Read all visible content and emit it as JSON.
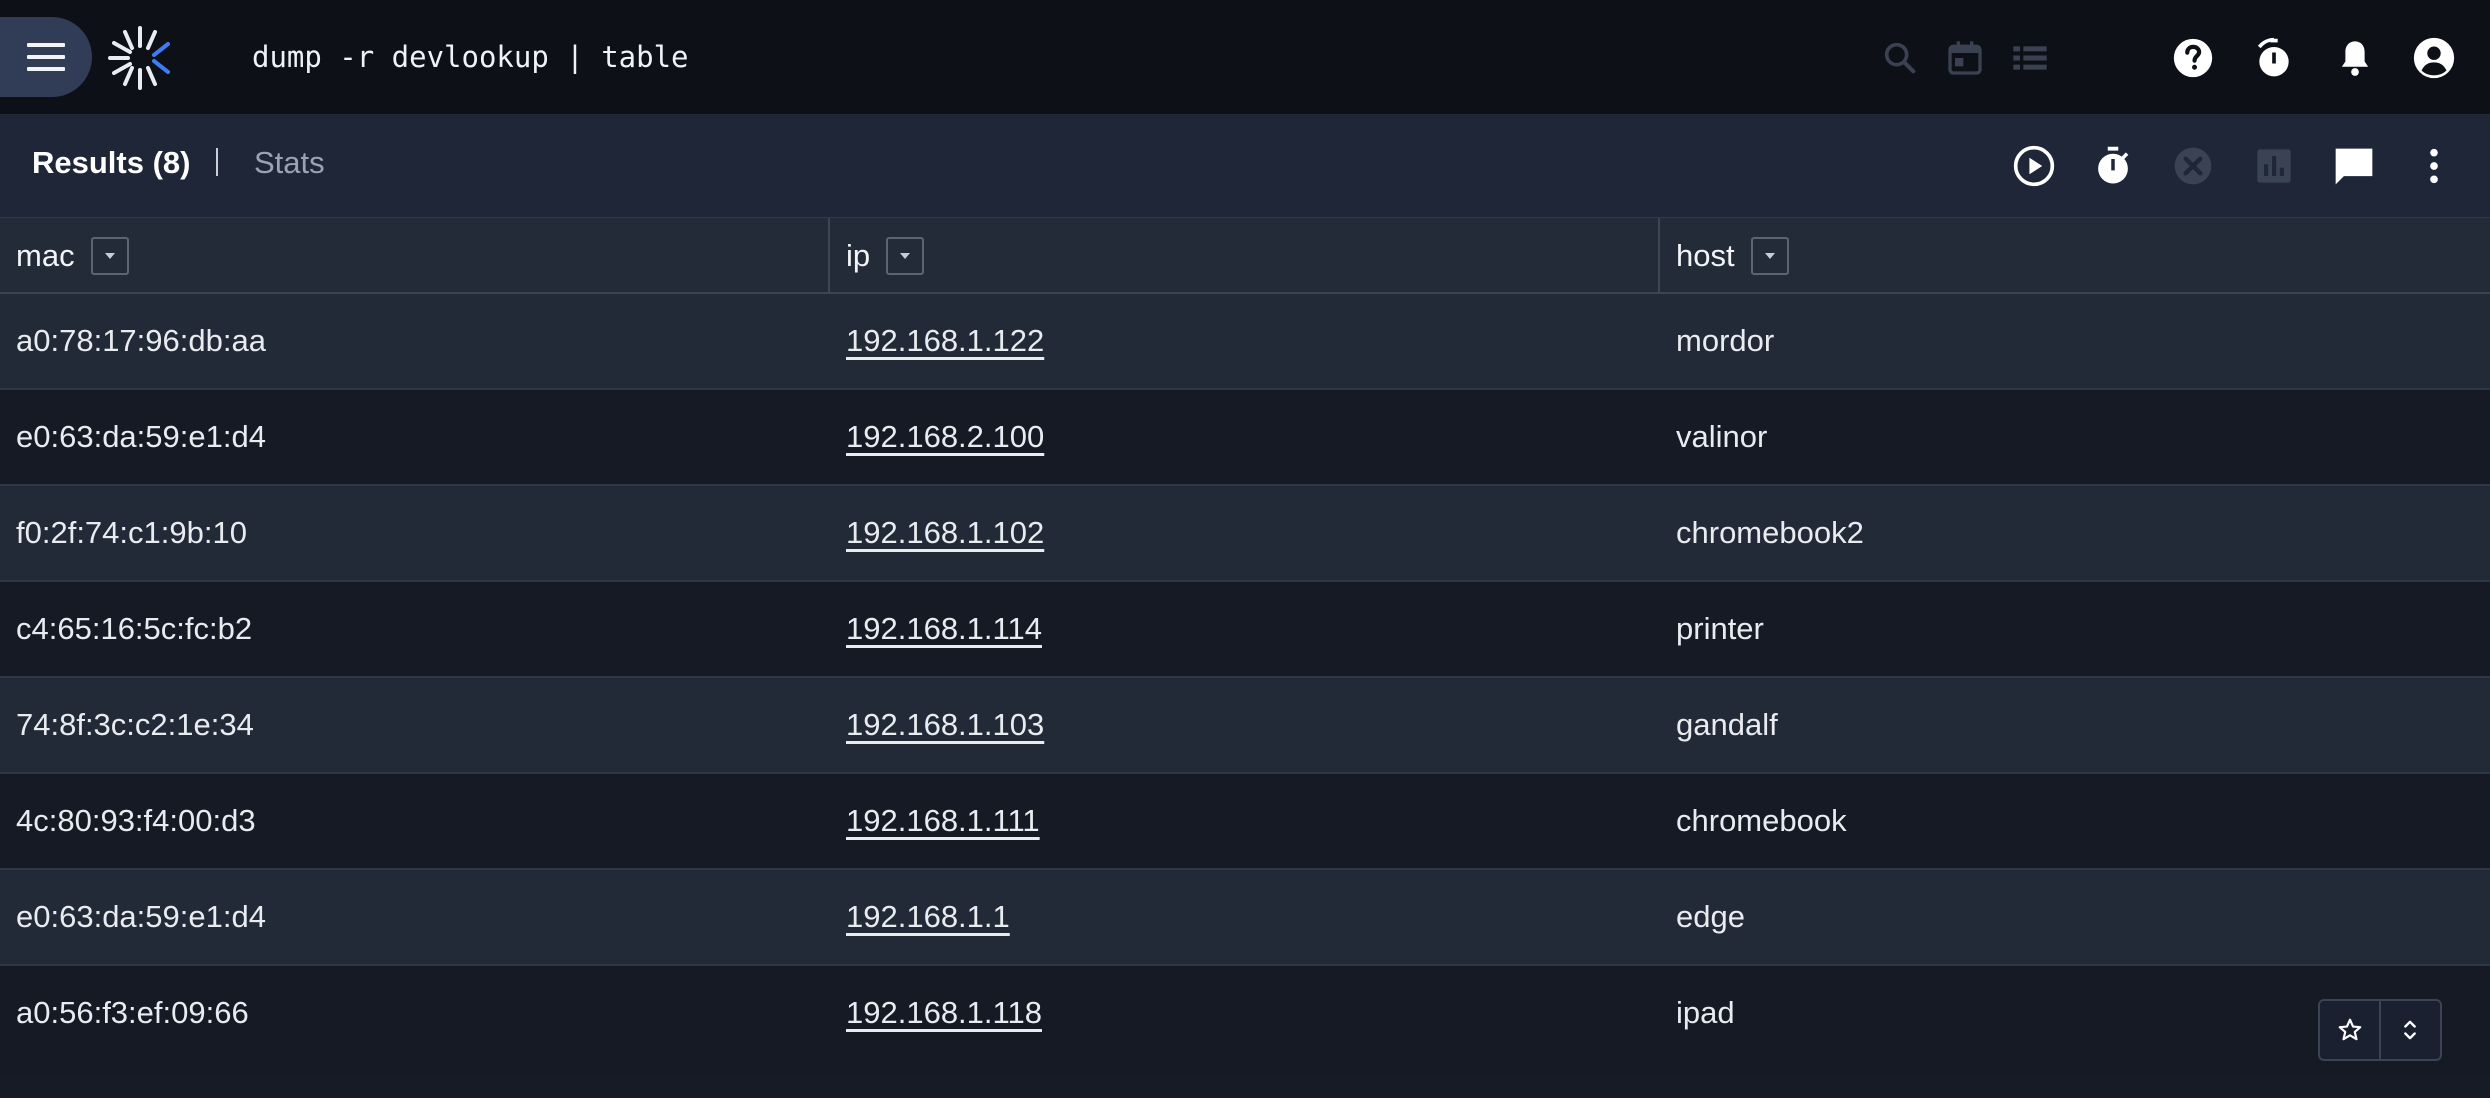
{
  "topbar": {
    "query": "dump -r devlookup | table",
    "icons": [
      "menu-icon",
      "logo-icon",
      "search-icon",
      "calendar-icon",
      "list-icon",
      "help-icon",
      "history-timer-icon",
      "notifications-icon",
      "account-icon"
    ]
  },
  "results_bar": {
    "results_tab": "Results (8)",
    "separator": "|",
    "stats_tab": "Stats",
    "icons": [
      "play-icon",
      "stopwatch-icon",
      "cancel-icon",
      "chart-icon",
      "comment-icon",
      "more-vert-icon"
    ]
  },
  "table": {
    "columns": [
      "mac",
      "ip",
      "host"
    ],
    "rows": [
      {
        "mac": "a0:78:17:96:db:aa",
        "ip": "192.168.1.122",
        "host": "mordor"
      },
      {
        "mac": "e0:63:da:59:e1:d4",
        "ip": "192.168.2.100",
        "host": "valinor"
      },
      {
        "mac": "f0:2f:74:c1:9b:10",
        "ip": "192.168.1.102",
        "host": "chromebook2"
      },
      {
        "mac": "c4:65:16:5c:fc:b2",
        "ip": "192.168.1.114",
        "host": "printer"
      },
      {
        "mac": "74:8f:3c:c2:1e:34",
        "ip": "192.168.1.103",
        "host": "gandalf"
      },
      {
        "mac": "4c:80:93:f4:00:d3",
        "ip": "192.168.1.111",
        "host": "chromebook"
      },
      {
        "mac": "e0:63:da:59:e1:d4",
        "ip": "192.168.1.1",
        "host": "edge"
      },
      {
        "mac": "a0:56:f3:ef:09:66",
        "ip": "192.168.1.118",
        "host": "ipad"
      }
    ]
  },
  "floating_actions": {
    "icons": [
      "star-outline-icon",
      "unfold-icon"
    ]
  },
  "colors": {
    "topbar_bg": "#0d1117",
    "results_bar_bg": "#1e2637",
    "header_bg": "#232b39",
    "row_odd_bg": "#222a38",
    "row_even_bg": "#151a25",
    "logo_accent": "#3f7bf5"
  }
}
